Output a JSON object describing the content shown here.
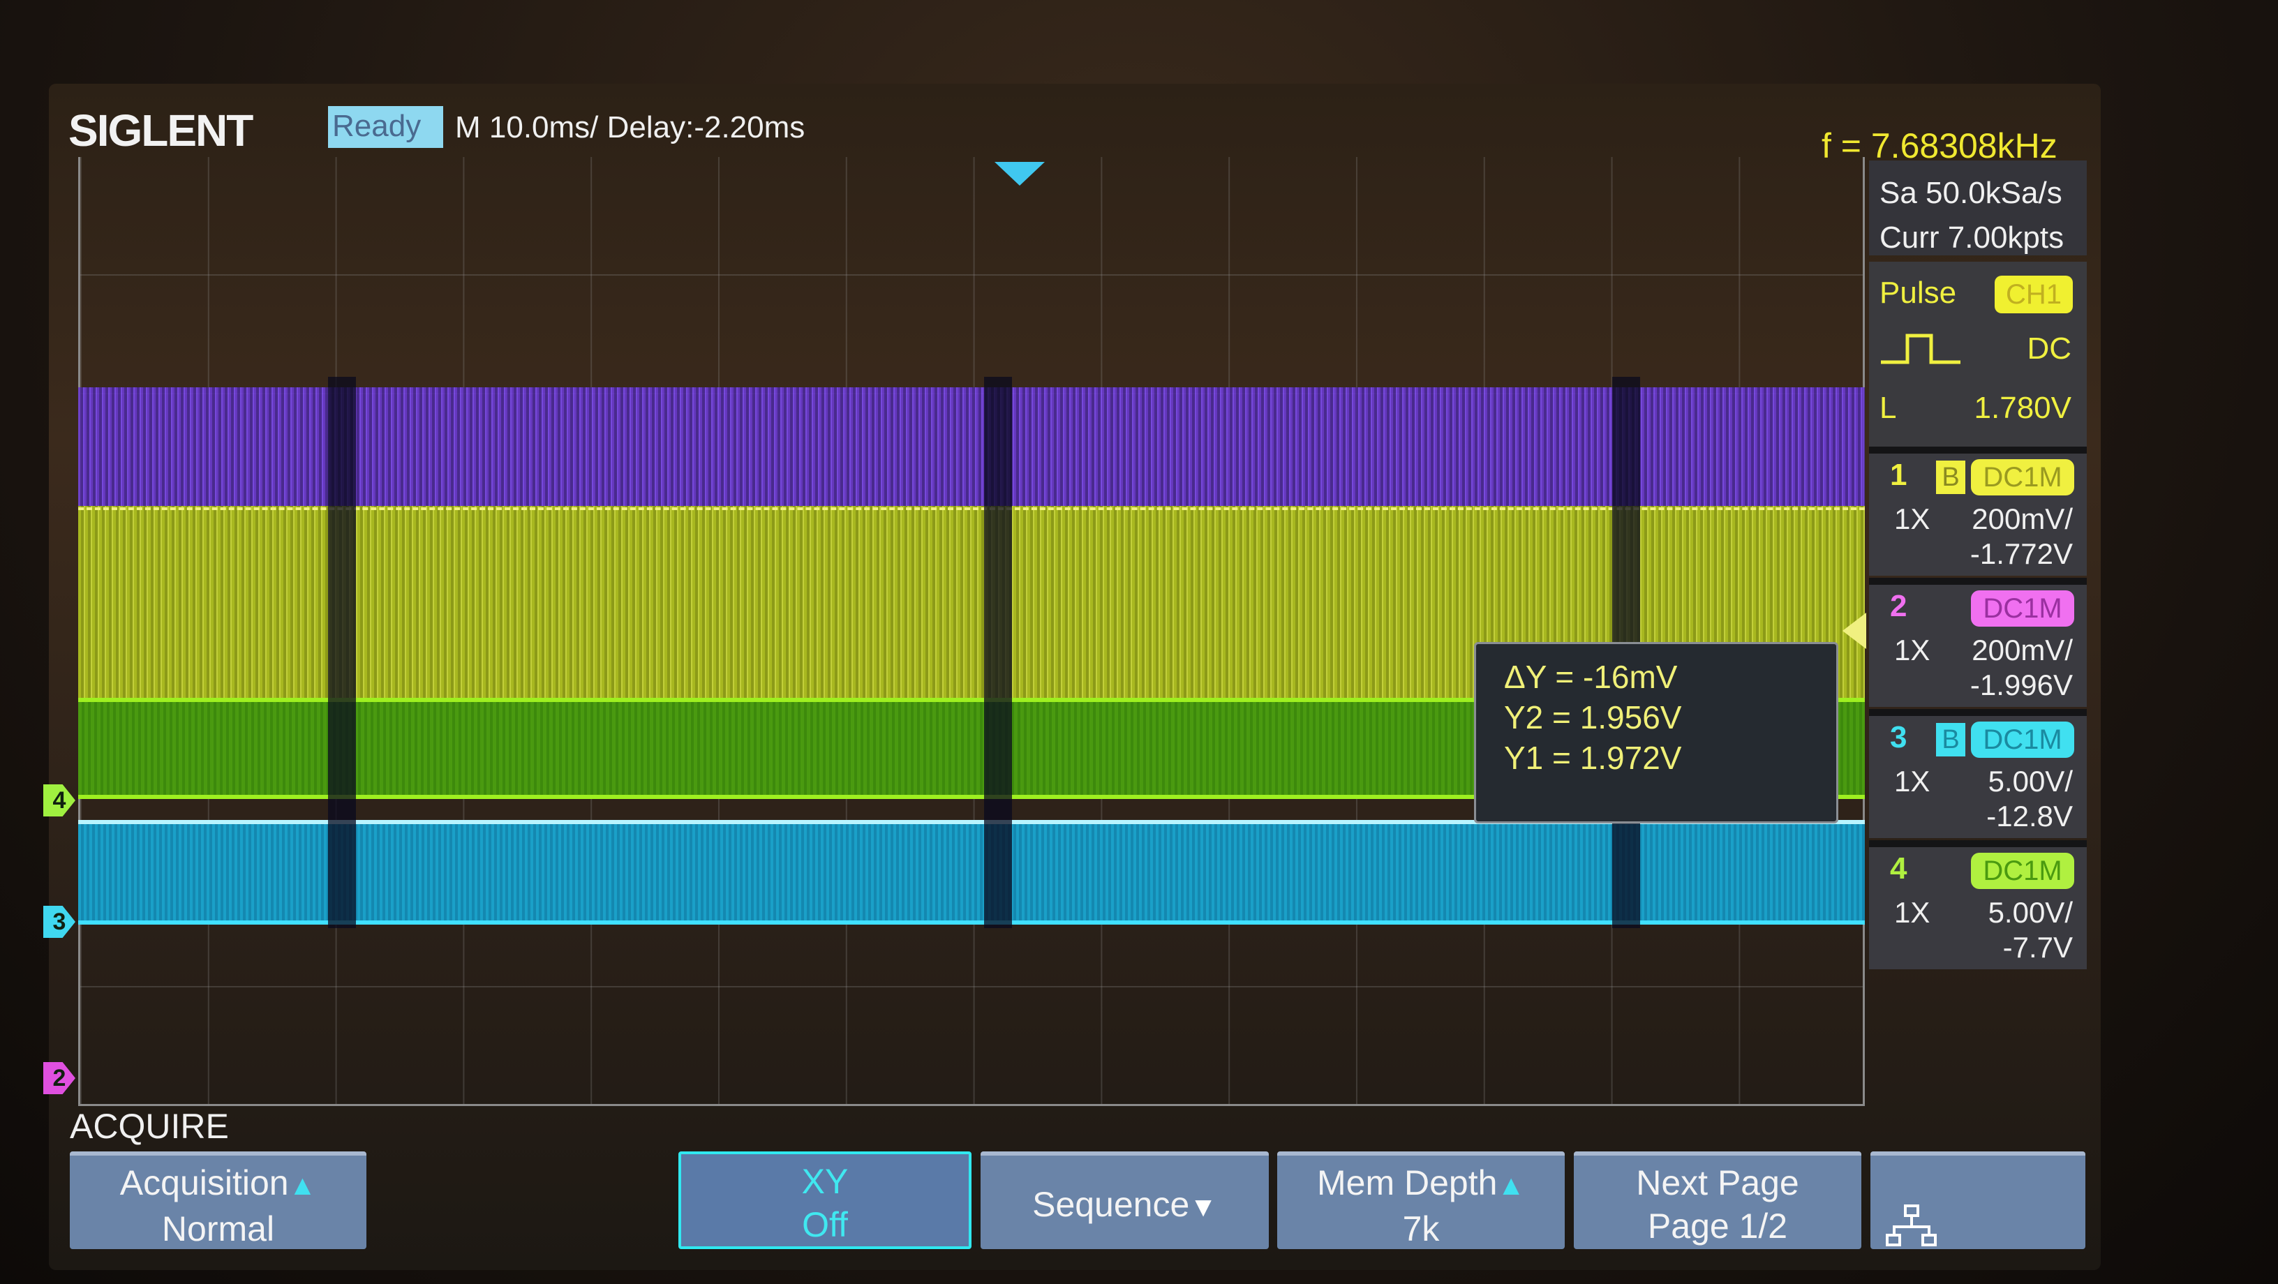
{
  "header": {
    "brand": "SIGLENT",
    "status": "Ready",
    "timebase": "M 10.0ms/ Delay:-2.20ms"
  },
  "measurements": {
    "frequency": "f = 7.68308kHz",
    "sample_rate": "Sa 50.0kSa/s",
    "memory": "Curr 7.00kpts"
  },
  "trigger": {
    "type": "Pulse",
    "source": "CH1",
    "coupling": "DC",
    "level_label": "L",
    "level": "1.780V",
    "icon": "pulse-icon"
  },
  "channels": [
    {
      "num": "1",
      "bw": "B",
      "coupling": "DC1M",
      "probe": "1X",
      "scale": "200mV/",
      "offset": "-1.772V",
      "color": "#f0f040"
    },
    {
      "num": "2",
      "bw": "",
      "coupling": "DC1M",
      "probe": "1X",
      "scale": "200mV/",
      "offset": "-1.996V",
      "color": "#f070f0"
    },
    {
      "num": "3",
      "bw": "B",
      "coupling": "DC1M",
      "probe": "1X",
      "scale": "5.00V/",
      "offset": "-12.8V",
      "color": "#40e0f0"
    },
    {
      "num": "4",
      "bw": "",
      "coupling": "DC1M",
      "probe": "1X",
      "scale": "5.00V/",
      "offset": "-7.7V",
      "color": "#b0f040"
    }
  ],
  "cursor": {
    "dy": "ΔY = -16mV",
    "y2": "Y2 = 1.956V",
    "y1": "Y1 = 1.972V"
  },
  "channel_markers": [
    "4",
    "3",
    "2"
  ],
  "menu": {
    "title": "ACQUIRE",
    "buttons": [
      {
        "line1": "Acquisition",
        "line2": "Normal"
      },
      {
        "line1": "XY",
        "line2": "Off"
      },
      {
        "line1": "Sequence",
        "line2": ""
      },
      {
        "line1": "Mem Depth",
        "line2": "7k"
      },
      {
        "line1": "Next Page",
        "line2": "Page 1/2"
      }
    ],
    "network_icon": "network-icon"
  }
}
